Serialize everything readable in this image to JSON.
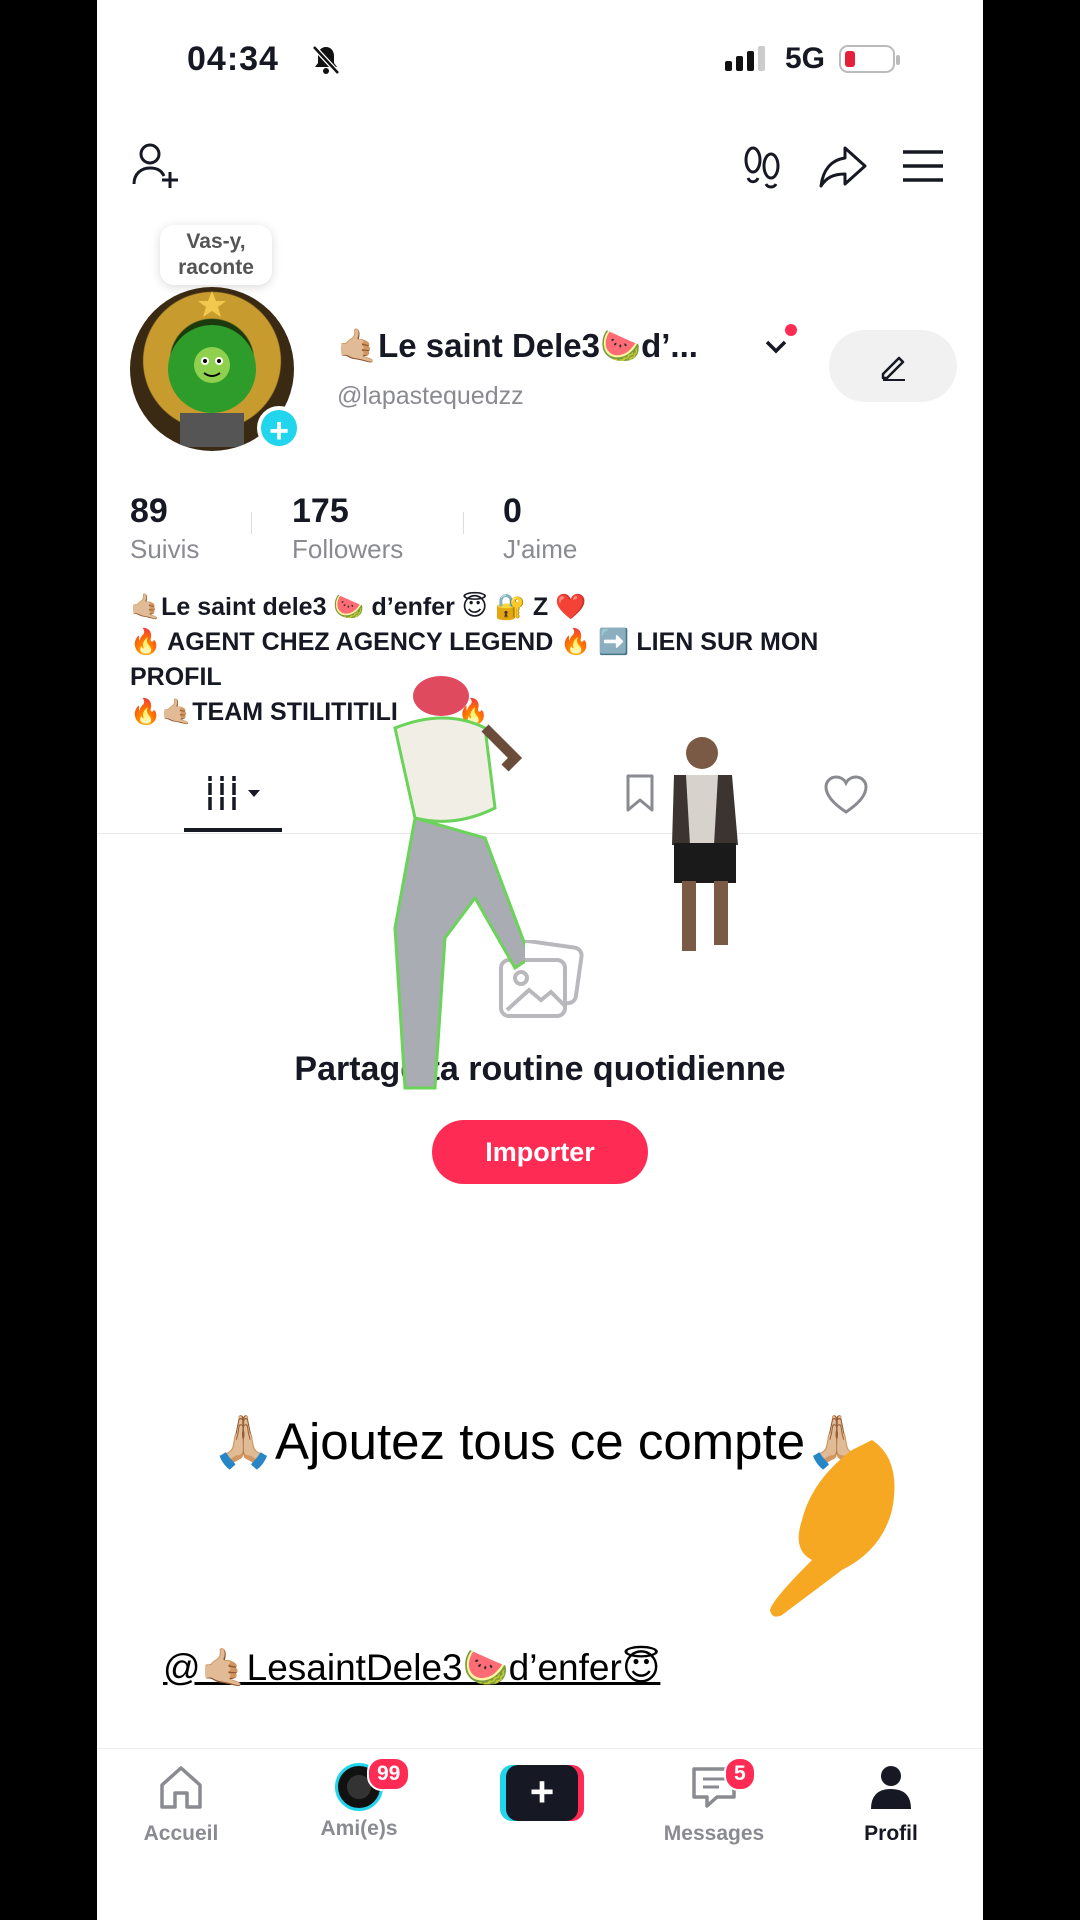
{
  "status_bar": {
    "time": "04:34",
    "network": "5G"
  },
  "profile": {
    "tooltip": "Vas-y, raconte",
    "display_name": "🤙🏼Le saint Dele3🍉d’...",
    "handle": "@lapastequedzz"
  },
  "stats": [
    {
      "value": "89",
      "label": "Suivis"
    },
    {
      "value": "175",
      "label": "Followers"
    },
    {
      "value": "0",
      "label": "J'aime"
    }
  ],
  "bio": {
    "line1": "🤙🏼Le saint dele3 🍉 d’enfer 😇 🔐 Z ❤️",
    "line2": "🔥 AGENT CHEZ AGENCY LEGEND 🔥 ➡️ LIEN SUR MON",
    "line3": "PROFIL",
    "line4": "🔥🤙🏼TEAM STILITITILI",
    "line4_end": "🔥"
  },
  "empty_state": {
    "title": "Partage ta routine quotidienne",
    "button": "Importer"
  },
  "overlay": {
    "caption": "🙏🏼Ajoutez tous ce compte🙏🏼",
    "mention": "@🤙🏼LesaintDele3🍉d’enfer😇"
  },
  "nav": {
    "home": "Accueil",
    "friends": "Ami(e)s",
    "friends_badge": "99",
    "messages": "Messages",
    "messages_badge": "5",
    "profile": "Profil"
  },
  "colors": {
    "accent": "#fe2c55",
    "cyan": "#20d5ec",
    "text": "#161823",
    "muted": "#8a8b91"
  }
}
